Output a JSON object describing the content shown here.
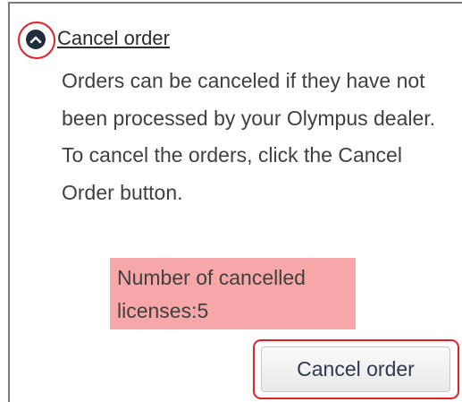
{
  "section": {
    "title": "Cancel order",
    "toggle_icon": "chevron-up-icon",
    "description": "Orders can be canceled if they have not been processed by your Olympus dealer. To cancel the orders, click the Cancel Order button.",
    "cancelled_count": {
      "line1": "Number of cancelled",
      "line2": "licenses:5"
    },
    "cancel_button_label": "Cancel order"
  },
  "colors": {
    "highlight_red": "#e0212a",
    "count_background": "#f8a7a8",
    "icon_dark": "#1f2d3d"
  }
}
